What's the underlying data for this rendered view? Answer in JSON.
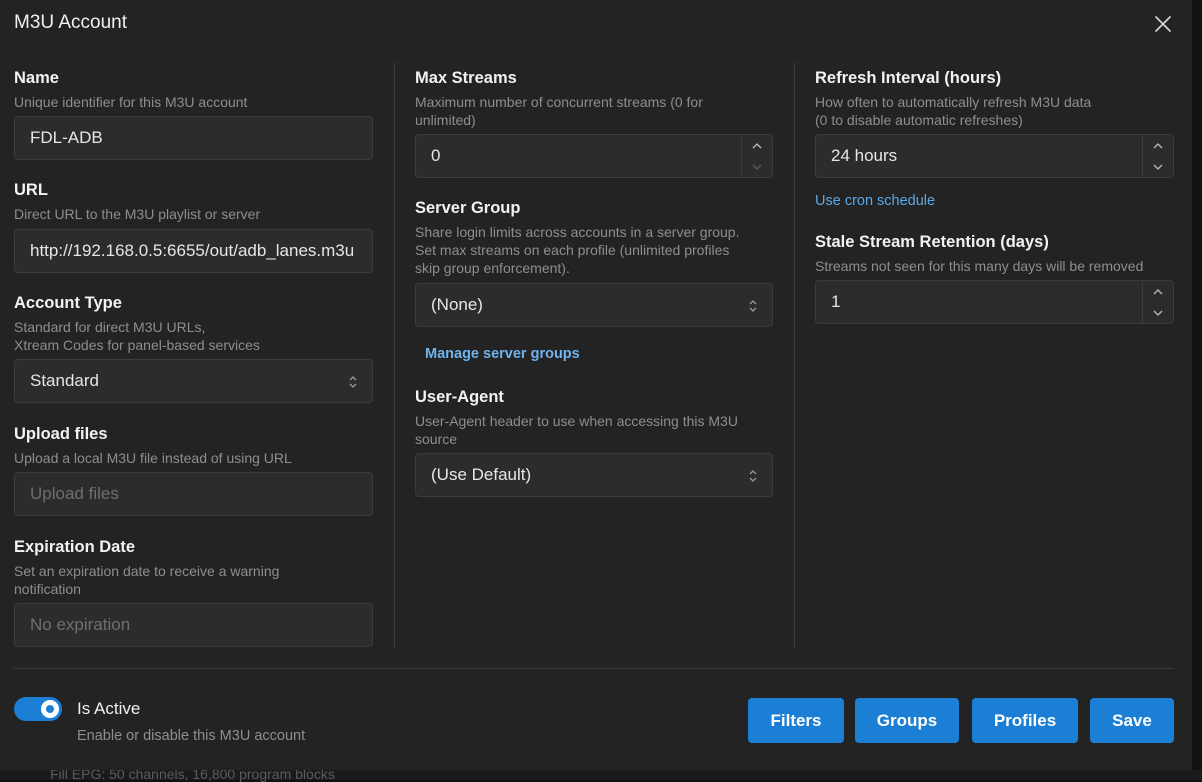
{
  "background": {
    "status_text": "Fill EPG: 50 channels, 16,800 program blocks"
  },
  "dialog": {
    "title": "M3U Account"
  },
  "fields": {
    "name": {
      "label": "Name",
      "description": "Unique identifier for this M3U account",
      "value": "FDL-ADB"
    },
    "url": {
      "label": "URL",
      "description": "Direct URL to the M3U playlist or server",
      "value": "http://192.168.0.5:6655/out/adb_lanes.m3u"
    },
    "account_type": {
      "label": "Account Type",
      "description_line1": "Standard for direct M3U URLs,",
      "description_line2": "Xtream Codes for panel-based services",
      "value": "Standard"
    },
    "upload_files": {
      "label": "Upload files",
      "description": "Upload a local M3U file instead of using URL",
      "placeholder": "Upload files"
    },
    "expiration_date": {
      "label": "Expiration Date",
      "description_line1": "Set an expiration date to receive a warning",
      "description_line2": "notification",
      "placeholder": "No expiration"
    },
    "max_streams": {
      "label": "Max Streams",
      "description_line1": "Maximum number of concurrent streams (0 for",
      "description_line2": "unlimited)",
      "value": "0"
    },
    "server_group": {
      "label": "Server Group",
      "description_line1": "Share login limits across accounts in a server group.",
      "description_line2": "Set max streams on each profile (unlimited profiles",
      "description_line3": "skip group enforcement).",
      "value": "(None)",
      "link": "Manage server groups"
    },
    "user_agent": {
      "label": "User-Agent",
      "description_line1": "User-Agent header to use when accessing this M3U",
      "description_line2": "source",
      "value": "(Use Default)"
    },
    "refresh_interval": {
      "label": "Refresh Interval (hours)",
      "description_line1": "How often to automatically refresh M3U data",
      "description_line2": "(0 to disable automatic refreshes)",
      "value": "24 hours",
      "link": "Use cron schedule"
    },
    "stale_retention": {
      "label": "Stale Stream Retention (days)",
      "description": "Streams not seen for this many days will be removed",
      "value": "1"
    }
  },
  "is_active": {
    "label": "Is Active",
    "description": "Enable or disable this M3U account",
    "enabled": true
  },
  "buttons": {
    "filters": "Filters",
    "groups": "Groups",
    "profiles": "Profiles",
    "save": "Save"
  },
  "colors": {
    "accent": "#1c7fd6",
    "link": "#5aa8e8",
    "dialog_bg": "#232323",
    "field_bg": "#2c2c2c"
  },
  "icons": {
    "close": "close-icon",
    "select": "chevron-updown-icon",
    "stepper_up": "chevron-up-icon",
    "stepper_down": "chevron-down-icon"
  }
}
